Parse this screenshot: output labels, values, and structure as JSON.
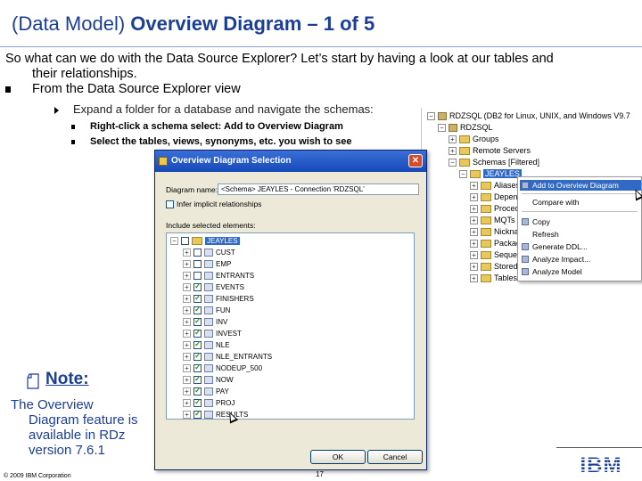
{
  "slide": {
    "title_prefix": "(Data Model) ",
    "title_bold": "Overview Diagram – 1 of 5"
  },
  "bullets": {
    "intro_line1": "So what can we do with the Data Source Explorer?  Let’s start by having a look at our tables and",
    "intro_line2": "their relationships.",
    "from_line": "From the Data Source Explorer view",
    "sub": "Expand a folder for a database and navigate the schemas:",
    "subsub1": "Right-click a schema select: Add to Overview Diagram",
    "subsub2": "Select the tables, views, synonyms, etc. you wish to see"
  },
  "explorer": {
    "rows": [
      {
        "label": "RDZSQL (DB2 for Linux, UNIX, and Windows V9.7",
        "icon": "database-icon"
      },
      {
        "label": "RDZSQL",
        "icon": "database-icon"
      },
      {
        "label": "Groups",
        "icon": "folder-icon"
      },
      {
        "label": "Remote Servers",
        "icon": "folder-icon"
      },
      {
        "label": "Schemas [Filtered]",
        "icon": "folder-icon"
      },
      {
        "label": "JEAYLES",
        "icon": "folder-icon"
      },
      {
        "label": "Aliases",
        "icon": "folder-icon"
      },
      {
        "label": "Dependencies",
        "icon": "folder-icon"
      },
      {
        "label": "Procedures",
        "icon": "folder-icon"
      },
      {
        "label": "MQTs",
        "icon": "folder-icon"
      },
      {
        "label": "Nicknames",
        "icon": "folder-icon"
      },
      {
        "label": "Packages",
        "icon": "folder-icon"
      },
      {
        "label": "Sequences",
        "icon": "folder-icon"
      },
      {
        "label": "Stored Procedures",
        "icon": "folder-icon"
      },
      {
        "label": "Tables",
        "icon": "folder-icon"
      }
    ]
  },
  "context_menu": {
    "items": [
      "Add to Overview Diagram",
      "Compare with",
      "Copy",
      "Refresh",
      "Generate DDL...",
      "Analyze Impact...",
      "Analyze Model"
    ]
  },
  "dialog": {
    "title": "Overview Diagram Selection",
    "close_glyph": "✕",
    "diagram_name_label": "Diagram name:",
    "diagram_name_value": "<Schema> JEAYLES - Connection 'RDZSQL'",
    "infer_label": "Infer implicit relationships",
    "include_label": "Include selected elements:",
    "schema": "JEAYLES",
    "elements": [
      "CUST",
      "EMP",
      "ENTRANTS",
      "EVENTS",
      "FINISHERS",
      "FUN",
      "INV",
      "INVEST",
      "NLE",
      "NLE_ENTRANTS",
      "NODEUP_500",
      "NOW",
      "PAY",
      "PROJ",
      "RESULTS"
    ],
    "checked": [
      false,
      false,
      false,
      true,
      true,
      true,
      true,
      true,
      true,
      true,
      true,
      true,
      true,
      true,
      true
    ],
    "ok_label": "OK",
    "cancel_label": "Cancel"
  },
  "note": {
    "title": "Note:",
    "line1": "The Overview",
    "line2": "Diagram feature is",
    "line3": "available in RDz",
    "line4": "version 7.6.1"
  },
  "footer": {
    "copyright": "© 2009 IBM Corporation",
    "page_number": "17",
    "logo_text": "IBM"
  },
  "colors": {
    "title": "#1c3f93",
    "selection": "#316ac5",
    "dialog_titlebar": "#1549b8",
    "dialog_body": "#ece9d8"
  }
}
